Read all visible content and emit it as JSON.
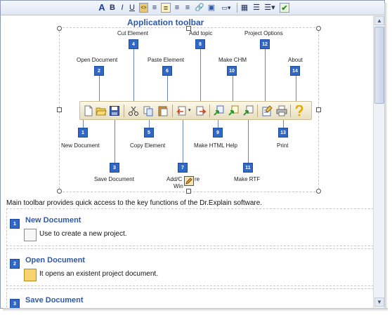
{
  "format_toolbar": {
    "buttons": [
      "A",
      "B",
      "I",
      "U",
      "<>",
      "≡",
      "≡",
      "≡",
      "≡",
      "🔗",
      "▣",
      "▭▾",
      "▦",
      "☰",
      "☰▾",
      "✔"
    ]
  },
  "diagram": {
    "title": "Application toolbar",
    "callouts": [
      {
        "num": "1",
        "label": "New Document"
      },
      {
        "num": "2",
        "label": "Open Document"
      },
      {
        "num": "3",
        "label": "Save Document"
      },
      {
        "num": "4",
        "label": "Cut Element"
      },
      {
        "num": "5",
        "label": "Copy Element"
      },
      {
        "num": "6",
        "label": "Paste Element"
      },
      {
        "num": "7",
        "label": "Add/C",
        "label_suffix": "re",
        "label_line2": "Win"
      },
      {
        "num": "8",
        "label": "Add topic"
      },
      {
        "num": "9",
        "label": "Make HTML Help"
      },
      {
        "num": "10",
        "label": "Make CHM"
      },
      {
        "num": "11",
        "label": "Make RTF"
      },
      {
        "num": "12",
        "label": "Project Options"
      },
      {
        "num": "13",
        "label": "Print"
      },
      {
        "num": "14",
        "label": "About"
      }
    ]
  },
  "description": "Main toolbar provides quick access to the key functions of the Dr.Explain software.",
  "items": [
    {
      "num": "1",
      "title": "New Document",
      "text": "Use to create a new project."
    },
    {
      "num": "2",
      "title": "Open Document",
      "text": "It opens an existent project document."
    },
    {
      "num": "3",
      "title": "Save Document",
      "text": ""
    }
  ],
  "colors": {
    "accent": "#2f59a8",
    "badge": "#2f68c9"
  }
}
